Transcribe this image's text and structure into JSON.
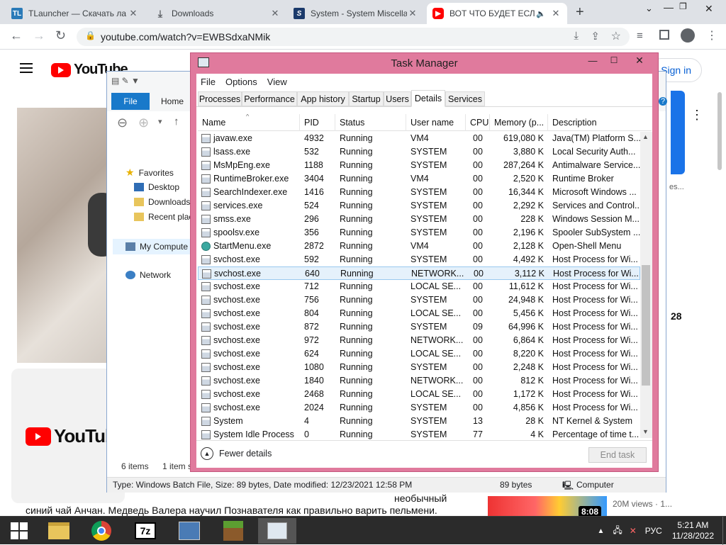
{
  "browser": {
    "tabs": [
      {
        "title": "TLauncher — Скачать ла",
        "favicon": "TL",
        "color": "#2a7ab8"
      },
      {
        "title": "Downloads",
        "favicon": "download-icon"
      },
      {
        "title": "System - System Miscella",
        "favicon": "S",
        "color": "#1b3a6b"
      },
      {
        "title": "ВОТ ЧТО БУДЕТ ЕСЛ",
        "favicon": "youtube-icon",
        "color": "#ff0000",
        "active": true
      }
    ],
    "url": "youtube.com/watch?v=EWBSdxaNMik",
    "new_tab": "+"
  },
  "youtube": {
    "logo": "YouTube",
    "sign_in": "Sign in",
    "caption_line1": "необычный",
    "caption_line2": "синий чай Анчан. Медведь Валера научил Познавателя как правильно варить пельмени.",
    "thumb_duration": "8:08",
    "views": "20M views · 1...",
    "side_text_1": "es...",
    "side_text_2": "28"
  },
  "explorer": {
    "ribbon_tabs": {
      "file": "File",
      "home": "Home"
    },
    "nav": {
      "favorites": "Favorites",
      "desktop": "Desktop",
      "downloads": "Downloads",
      "recent": "Recent plac",
      "computer": "My Compute",
      "network": "Network"
    },
    "status_items": "6 items",
    "status_selected": "1 item s",
    "details_bar": "Type: Windows Batch File, Size: 89 bytes, Date modified: 12/23/2021 12:58 PM",
    "size": "89 bytes",
    "location": "Computer"
  },
  "taskmanager": {
    "title": "Task Manager",
    "menu": [
      "File",
      "Options",
      "View"
    ],
    "tabs": [
      "Processes",
      "Performance",
      "App history",
      "Startup",
      "Users",
      "Details",
      "Services"
    ],
    "active_tab": "Details",
    "columns": [
      "Name",
      "PID",
      "Status",
      "User name",
      "CPU",
      "Memory (p...",
      "Description"
    ],
    "rows": [
      [
        "javaw.exe",
        "4932",
        "Running",
        "VM4",
        "00",
        "619,080 K",
        "Java(TM) Platform S..."
      ],
      [
        "lsass.exe",
        "532",
        "Running",
        "SYSTEM",
        "00",
        "3,880 K",
        "Local Security Auth..."
      ],
      [
        "MsMpEng.exe",
        "1188",
        "Running",
        "SYSTEM",
        "00",
        "287,264 K",
        "Antimalware Service..."
      ],
      [
        "RuntimeBroker.exe",
        "3404",
        "Running",
        "VM4",
        "00",
        "2,520 K",
        "Runtime Broker"
      ],
      [
        "SearchIndexer.exe",
        "1416",
        "Running",
        "SYSTEM",
        "00",
        "16,344 K",
        "Microsoft Windows ..."
      ],
      [
        "services.exe",
        "524",
        "Running",
        "SYSTEM",
        "00",
        "2,292 K",
        "Services and Control..."
      ],
      [
        "smss.exe",
        "296",
        "Running",
        "SYSTEM",
        "00",
        "228 K",
        "Windows Session M..."
      ],
      [
        "spoolsv.exe",
        "356",
        "Running",
        "SYSTEM",
        "00",
        "2,196 K",
        "Spooler SubSystem ..."
      ],
      [
        "StartMenu.exe",
        "2872",
        "Running",
        "VM4",
        "00",
        "2,128 K",
        "Open-Shell Menu"
      ],
      [
        "svchost.exe",
        "592",
        "Running",
        "SYSTEM",
        "00",
        "4,492 K",
        "Host Process for Wi..."
      ],
      [
        "svchost.exe",
        "640",
        "Running",
        "NETWORK...",
        "00",
        "3,112 K",
        "Host Process for Wi..."
      ],
      [
        "svchost.exe",
        "712",
        "Running",
        "LOCAL SE...",
        "00",
        "11,612 K",
        "Host Process for Wi..."
      ],
      [
        "svchost.exe",
        "756",
        "Running",
        "SYSTEM",
        "00",
        "24,948 K",
        "Host Process for Wi..."
      ],
      [
        "svchost.exe",
        "804",
        "Running",
        "LOCAL SE...",
        "00",
        "5,456 K",
        "Host Process for Wi..."
      ],
      [
        "svchost.exe",
        "872",
        "Running",
        "SYSTEM",
        "09",
        "64,996 K",
        "Host Process for Wi..."
      ],
      [
        "svchost.exe",
        "972",
        "Running",
        "NETWORK...",
        "00",
        "6,864 K",
        "Host Process for Wi..."
      ],
      [
        "svchost.exe",
        "624",
        "Running",
        "LOCAL SE...",
        "00",
        "8,220 K",
        "Host Process for Wi..."
      ],
      [
        "svchost.exe",
        "1080",
        "Running",
        "SYSTEM",
        "00",
        "2,248 K",
        "Host Process for Wi..."
      ],
      [
        "svchost.exe",
        "1840",
        "Running",
        "NETWORK...",
        "00",
        "812 K",
        "Host Process for Wi..."
      ],
      [
        "svchost.exe",
        "2468",
        "Running",
        "LOCAL SE...",
        "00",
        "1,172 K",
        "Host Process for Wi..."
      ],
      [
        "svchost.exe",
        "2024",
        "Running",
        "SYSTEM",
        "00",
        "4,856 K",
        "Host Process for Wi..."
      ],
      [
        "System",
        "4",
        "Running",
        "SYSTEM",
        "13",
        "28 K",
        "NT Kernel & System"
      ],
      [
        "System Idle Process",
        "0",
        "Running",
        "SYSTEM",
        "77",
        "4 K",
        "Percentage of time t..."
      ]
    ],
    "selected_row": 10,
    "fewer_details": "Fewer details",
    "end_task": "End task"
  },
  "taskbar": {
    "apps": [
      "start-icon",
      "file-explorer-icon",
      "chrome-icon",
      "7zip-icon",
      "control-panel-icon",
      "minecraft-icon",
      "task-manager-icon"
    ],
    "lang": "РУС",
    "time": "5:21 AM",
    "date": "11/28/2022"
  }
}
